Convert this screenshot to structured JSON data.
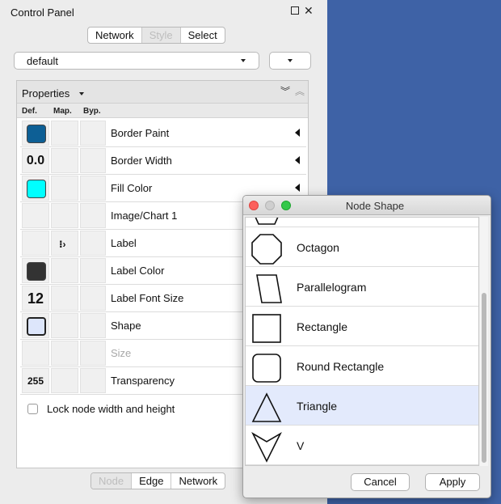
{
  "panel": {
    "title": "Control Panel",
    "top_tabs": [
      "Network",
      "Style",
      "Select"
    ],
    "style_combo": "default",
    "bottom_tabs": [
      "Node",
      "Edge",
      "Network"
    ]
  },
  "properties": {
    "title": "Properties",
    "columns": [
      "Def.",
      "Map.",
      "Byp."
    ],
    "rows": [
      {
        "label": "Border Paint",
        "def": "",
        "swatch": "#0d5f95"
      },
      {
        "label": "Border Width",
        "def": "0.0"
      },
      {
        "label": "Fill Color",
        "def": "",
        "swatch": "#00ffff"
      },
      {
        "label": "Image/Chart 1",
        "def": ""
      },
      {
        "label": "Label",
        "def": ""
      },
      {
        "label": "Label Color",
        "def": "",
        "swatch": "#333333"
      },
      {
        "label": "Label Font Size",
        "def": "12"
      },
      {
        "label": "Shape",
        "def": "",
        "swatch": "#dde6fb"
      },
      {
        "label": "Size",
        "def": ""
      },
      {
        "label": "Transparency",
        "def": "255"
      }
    ],
    "lock_label": "Lock node width and height"
  },
  "dialog": {
    "title": "Node Shape",
    "shapes": [
      {
        "label": "Octagon",
        "icon": "octagon-icon"
      },
      {
        "label": "Parallelogram",
        "icon": "parallelogram-icon"
      },
      {
        "label": "Rectangle",
        "icon": "rectangle-icon"
      },
      {
        "label": "Round Rectangle",
        "icon": "round-rectangle-icon"
      },
      {
        "label": "Triangle",
        "icon": "triangle-icon"
      },
      {
        "label": "V",
        "icon": "v-icon"
      }
    ],
    "selected": "Triangle",
    "cancel_label": "Cancel",
    "apply_label": "Apply"
  },
  "colors": {
    "desktop": "#3e62a6",
    "selection": "#e3eafc"
  }
}
